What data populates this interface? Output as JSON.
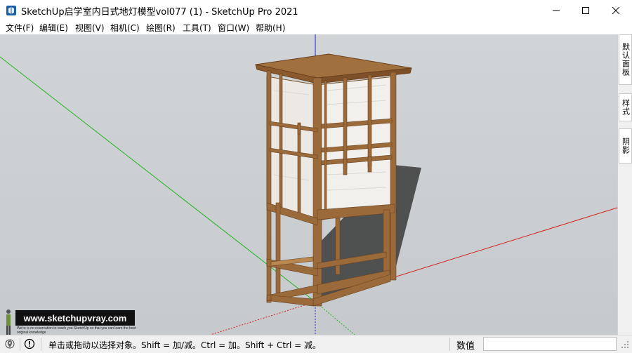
{
  "window": {
    "title": "SketchUp启学室内日式地灯模型vol077 (1) - SketchUp Pro 2021",
    "app_icon": "sketchup-logo-icon",
    "controls": [
      "minimize-icon",
      "maximize-icon",
      "close-icon"
    ]
  },
  "menu": {
    "items": [
      "文件(F)",
      "编辑(E)",
      "视图(V)",
      "相机(C)",
      "绘图(R)",
      "工具(T)",
      "窗口(W)",
      "帮助(H)"
    ]
  },
  "tray": {
    "tabs": [
      "默认面板",
      "样式",
      "阴影"
    ]
  },
  "watermark": {
    "site": "www.sketchupvray.com",
    "tagline": "We're is no reservation to teach you SketchUp so that you can learn the best original knowledge"
  },
  "status": {
    "hint": "单击或拖动以选择对象。Shift = 加/减。Ctrl = 加。Shift + Ctrl = 减。",
    "measure_label": "数值",
    "measure_value": "",
    "icons": [
      "geo-location-icon",
      "info-icon"
    ]
  },
  "colors": {
    "axis_red": "#d62020",
    "axis_green": "#22b322",
    "axis_blue": "#2020d0",
    "viewport_bg": "#c8ccce",
    "wood": "#9a6a3a"
  }
}
